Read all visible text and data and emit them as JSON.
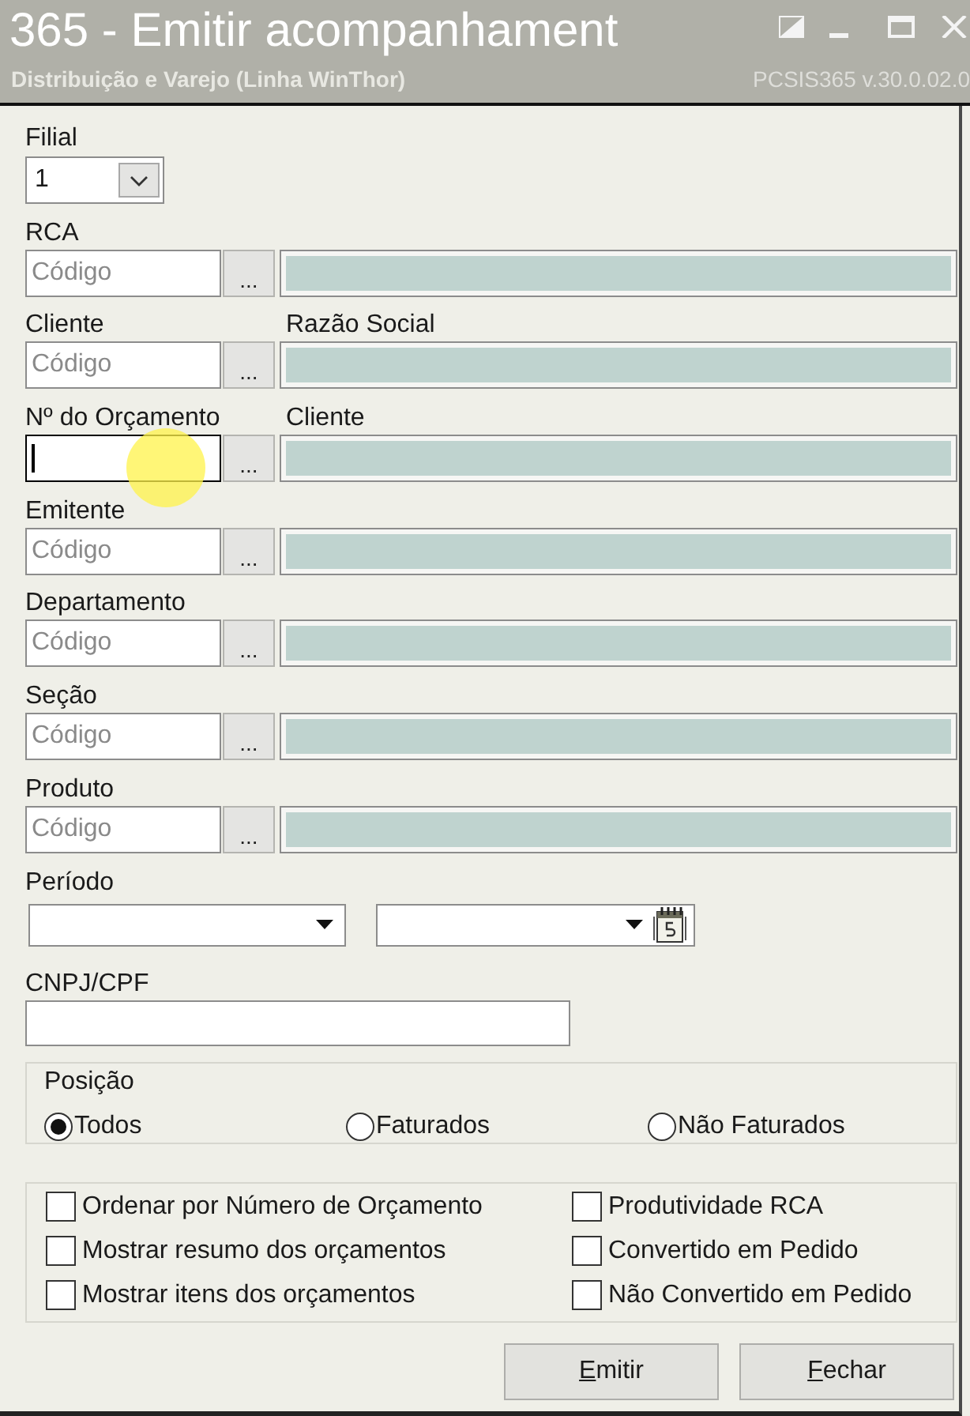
{
  "window": {
    "title": "365 - Emitir acompanhament",
    "subtitle": "Distribuição e Varejo (Linha WinThor)",
    "version": "PCSIS365 v.30.0.02.0"
  },
  "filial": {
    "label": "Filial",
    "value": "1"
  },
  "lookups": [
    {
      "label": "RCA",
      "placeholder": "Código",
      "focused": false,
      "button": "..."
    },
    {
      "label": "Cliente",
      "description_label": "Razão Social",
      "placeholder": "Código",
      "focused": false,
      "button": "..."
    },
    {
      "label": "Nº do Orçamento",
      "description_label": "Cliente",
      "focused": true,
      "button": "..."
    },
    {
      "label": "Emitente",
      "placeholder": "Código",
      "focused": false,
      "button": "..."
    },
    {
      "label": "Departamento",
      "placeholder": "Código",
      "focused": false,
      "button": "..."
    },
    {
      "label": "Seção",
      "placeholder": "Código",
      "focused": false,
      "button": "..."
    },
    {
      "label": "Produto",
      "placeholder": "Código",
      "focused": false,
      "button": "..."
    }
  ],
  "periodo": {
    "label": "Período"
  },
  "cnpj_cpf": {
    "label": "CNPJ/CPF"
  },
  "posicao": {
    "label": "Posição",
    "options": [
      {
        "label": "Todos",
        "selected": true
      },
      {
        "label": "Faturados",
        "selected": false
      },
      {
        "label": "Não Faturados",
        "selected": false
      }
    ]
  },
  "checkboxes": [
    {
      "label": "Ordenar por Número de Orçamento",
      "checked": false
    },
    {
      "label": "Produtividade RCA",
      "checked": false
    },
    {
      "label": "Mostrar resumo dos orçamentos",
      "checked": false
    },
    {
      "label": "Convertido em Pedido",
      "checked": false
    },
    {
      "label": "Mostrar itens dos orçamentos",
      "checked": false
    },
    {
      "label": "Não Convertido em Pedido",
      "checked": false
    }
  ],
  "buttons": [
    {
      "label": "Emitir",
      "mnemonic": true
    },
    {
      "label": "Fechar",
      "mnemonic": true
    }
  ]
}
